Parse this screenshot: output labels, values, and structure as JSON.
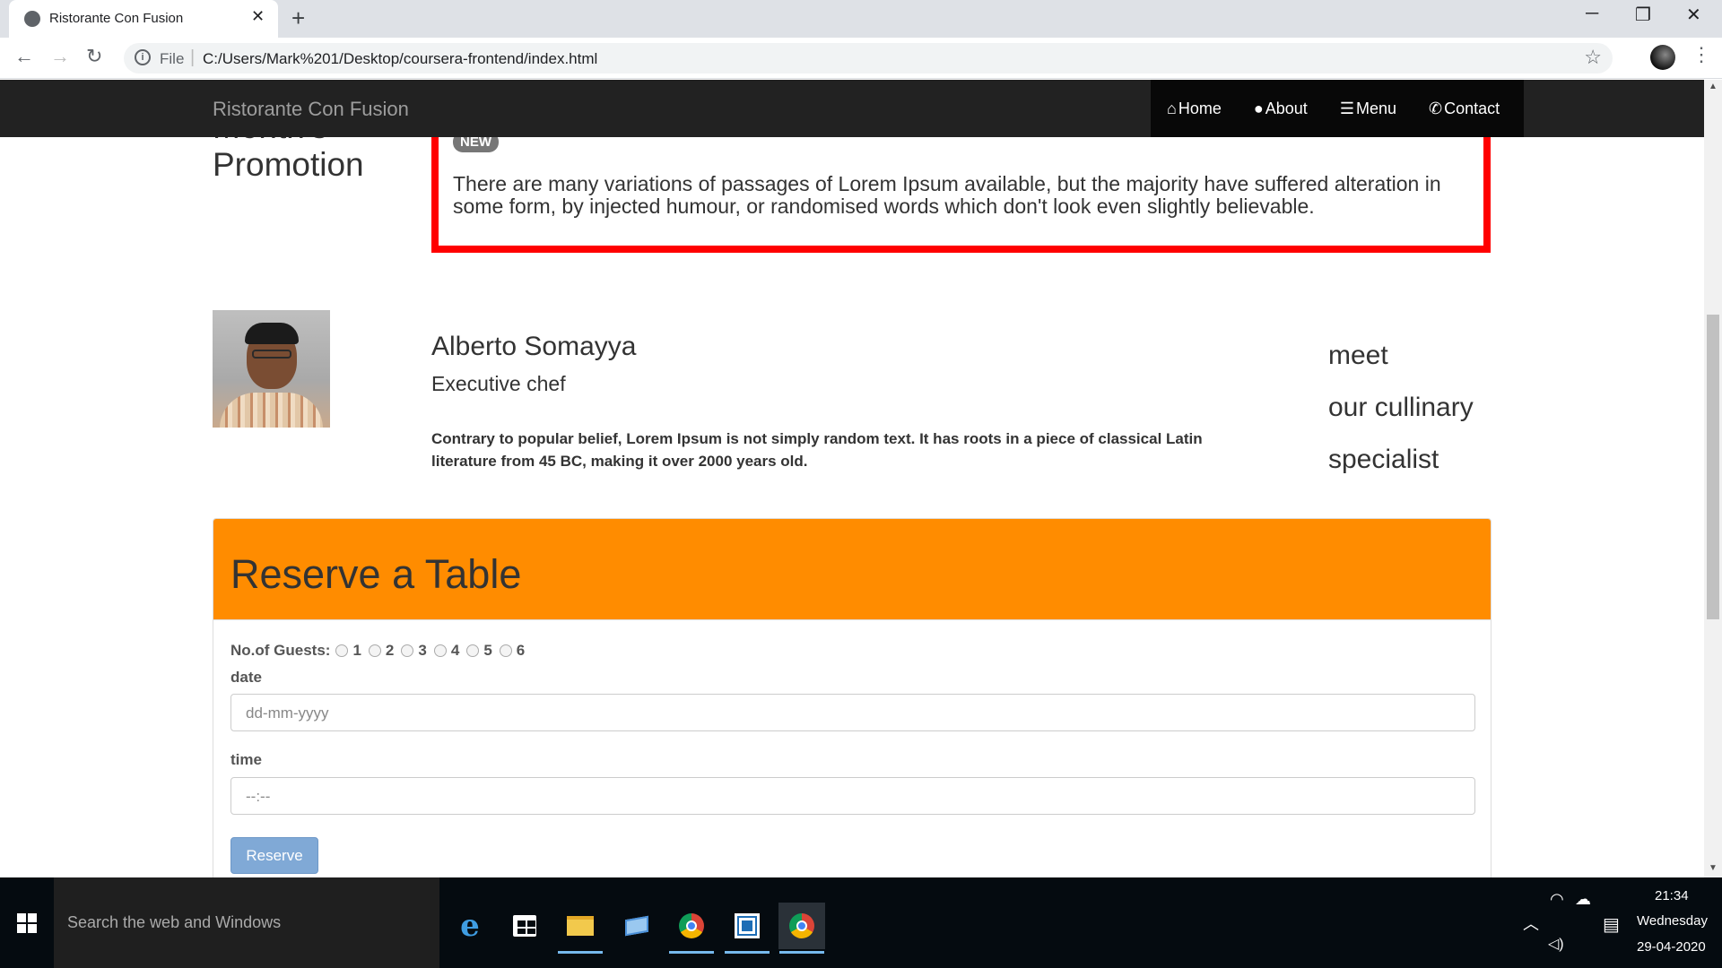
{
  "browser": {
    "tab_title": "Ristorante Con Fusion",
    "tab_close": "✕",
    "new_tab": "+",
    "file_label": "File",
    "url": "C:/Users/Mark%201/Desktop/coursera-frontend/index.html",
    "window_minimize": "─",
    "window_restore": "❐",
    "window_close": "✕"
  },
  "navbar": {
    "brand": "Ristorante Con Fusion",
    "links": [
      {
        "icon": "home-icon",
        "label": "Home"
      },
      {
        "icon": "user-icon",
        "label": "About"
      },
      {
        "icon": "list-icon",
        "label": "Menu"
      },
      {
        "icon": "phone-icon",
        "label": "Contact"
      }
    ]
  },
  "promotion": {
    "heading_partial": "Month's",
    "heading": "Promotion",
    "badge": "NEW",
    "text": "There are many variations of passages of Lorem Ipsum available, but the majority have suffered alteration in some form, by injected humour, or randomised words which don't look even slightly believable."
  },
  "chef": {
    "name": "Alberto Somayya",
    "title": "Executive chef",
    "bio": "Contrary to popular belief, Lorem Ipsum is not simply random text. It has roots in a piece of classical Latin literature from 45 BC, making it over 2000 years old.",
    "meet_lines": [
      "meet",
      "our cullinary",
      "specialist"
    ]
  },
  "reserve": {
    "title": "Reserve a Table",
    "guests_label": "No.of Guests:",
    "guest_options": [
      "1",
      "2",
      "3",
      "4",
      "5",
      "6"
    ],
    "date_label": "date",
    "date_placeholder": "dd-mm-yyyy",
    "time_label": "time",
    "time_placeholder": "--:--",
    "button_label": "Reserve"
  },
  "taskbar": {
    "search_placeholder": "Search the web and Windows",
    "time": "21:34",
    "day": "Wednesday",
    "date": "29-04-2020",
    "pinned": [
      "edge-icon",
      "store-icon",
      "file-explorer-icon",
      "remote-desktop-icon",
      "chrome-icon",
      "visual-studio-icon",
      "chrome-icon"
    ]
  },
  "colors": {
    "navbar_bg": "#222222",
    "promo_border": "#ff0000",
    "reserve_header": "#ff8c00",
    "reserve_button": "#80a9d6"
  }
}
